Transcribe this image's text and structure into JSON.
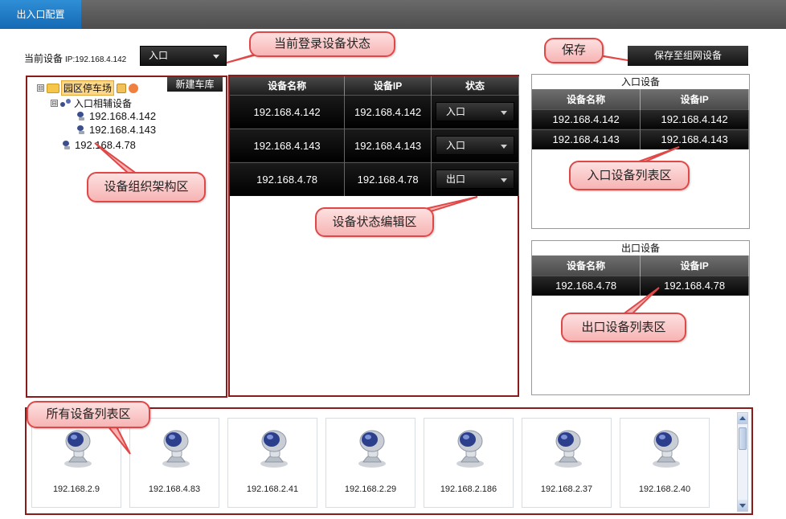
{
  "tabs": [
    {
      "label": "出入口配置"
    }
  ],
  "current_device": {
    "label": "当前设备",
    "ip": "IP:192.168.4.142",
    "status": "入口"
  },
  "buttons": {
    "save_to_network": "保存至组网设备",
    "new_garage": "新建车库"
  },
  "tree": {
    "root": "园区停车场",
    "group": "入口相辅设备",
    "group_children": [
      "192.168.4.142",
      "192.168.4.143"
    ],
    "standalone": "192.168.4.78",
    "expand_glyph": "⊟"
  },
  "status_table": {
    "headers": [
      "设备名称",
      "设备IP",
      "状态"
    ],
    "rows": [
      {
        "name": "192.168.4.142",
        "ip": "192.168.4.142",
        "status": "入口"
      },
      {
        "name": "192.168.4.143",
        "ip": "192.168.4.143",
        "status": "入口"
      },
      {
        "name": "192.168.4.78",
        "ip": "192.168.4.78",
        "status": "出口"
      }
    ]
  },
  "entrance_list": {
    "title": "入口设备",
    "headers": [
      "设备名称",
      "设备IP"
    ],
    "rows": [
      {
        "name": "192.168.4.142",
        "ip": "192.168.4.142"
      },
      {
        "name": "192.168.4.143",
        "ip": "192.168.4.143"
      }
    ]
  },
  "exit_list": {
    "title": "出口设备",
    "headers": [
      "设备名称",
      "设备IP"
    ],
    "rows": [
      {
        "name": "192.168.4.78",
        "ip": "192.168.4.78"
      }
    ]
  },
  "all_devices": [
    "192.168.2.9",
    "192.168.4.83",
    "192.168.2.41",
    "192.168.2.29",
    "192.168.2.186",
    "192.168.2.37",
    "192.168.2.40"
  ],
  "callouts": {
    "login_status": "当前登录设备状态",
    "save": "保存",
    "org_area": "设备组织架构区",
    "status_edit": "设备状态编辑区",
    "entrance_area": "入口设备列表区",
    "exit_area": "出口设备列表区",
    "all_area": "所有设备列表区"
  },
  "colors": {
    "tab_blue": "#1a78c2",
    "annotation_red": "#e04848",
    "frame_dark_red": "#8b1a1a"
  }
}
